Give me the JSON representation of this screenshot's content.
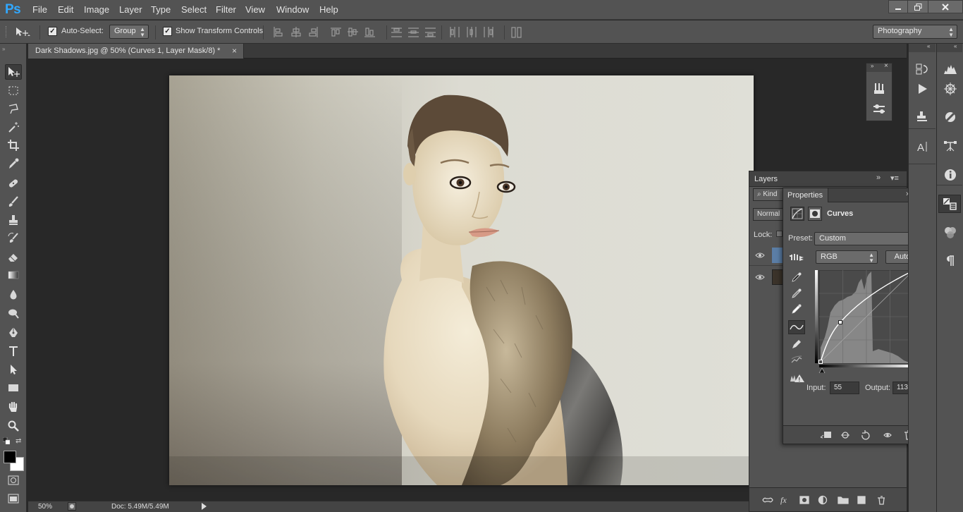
{
  "app": {
    "logo": "Ps",
    "menu": [
      "File",
      "Edit",
      "Image",
      "Layer",
      "Type",
      "Select",
      "Filter",
      "View",
      "Window",
      "Help"
    ],
    "window_controls": [
      "minimize",
      "restore",
      "close"
    ]
  },
  "options_bar": {
    "auto_select_label": "Auto-Select:",
    "auto_select_checked": true,
    "auto_select_value": "Group",
    "show_transform_label": "Show Transform Controls",
    "show_transform_checked": true,
    "workspace": "Photography"
  },
  "document": {
    "tab_title": "Dark Shadows.jpg @ 50% (Curves 1, Layer Mask/8) *",
    "close_glyph": "×"
  },
  "status_bar": {
    "zoom": "50%",
    "doc_info": "Doc: 5.49M/5.49M"
  },
  "layers_panel": {
    "tab": "Layers",
    "filter_kind": "Kind",
    "blend_mode": "Normal",
    "lock_label": "Lock:"
  },
  "properties_panel": {
    "tab": "Properties",
    "adjustment_name": "Curves",
    "preset_label": "Preset:",
    "preset_value": "Custom",
    "channel": "RGB",
    "auto_button": "Auto",
    "input_label": "Input:",
    "input_value": "55",
    "output_label": "Output:",
    "output_value": "113"
  },
  "colors": {
    "ui_bg": "#535353",
    "workspace_bg": "#282828",
    "ps_blue": "#31a8ff",
    "foreground_swatch": "#000000",
    "background_swatch": "#ffffff"
  },
  "icons": {
    "tools": [
      "move-icon",
      "marquee-icon",
      "lasso-icon",
      "magic-wand-icon",
      "crop-icon",
      "eyedropper-icon",
      "healing-brush-icon",
      "brush-icon",
      "clone-stamp-icon",
      "history-brush-icon",
      "eraser-icon",
      "gradient-icon",
      "blur-icon",
      "dodge-icon",
      "pen-icon",
      "type-icon",
      "path-selection-icon",
      "rectangle-icon",
      "hand-icon",
      "zoom-icon"
    ]
  }
}
